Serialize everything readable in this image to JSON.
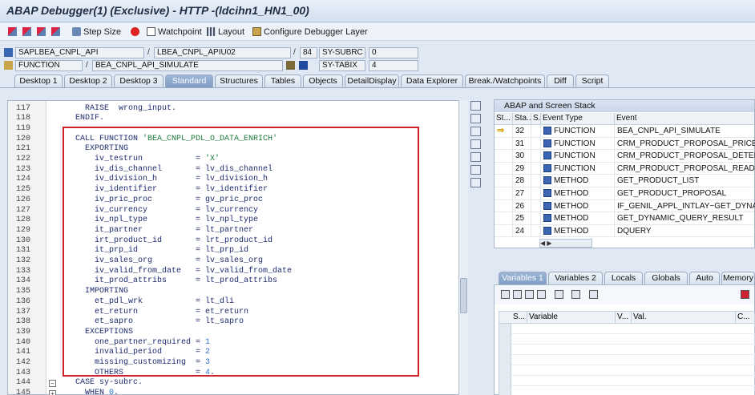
{
  "window": {
    "title": "ABAP Debugger(1)  (Exclusive) - HTTP -(ldcihn1_HN1_00)"
  },
  "toolbar": {
    "step_size": "Step Size",
    "watchpoint": "Watchpoint",
    "layout": "Layout",
    "configure": "Configure Debugger Layer"
  },
  "info": {
    "program": "SAPLBEA_CNPL_API",
    "include": "LBEA_CNPL_APIU02",
    "line": "84",
    "subrc_label": "SY-SUBRC",
    "subrc_value": "0",
    "event_type": "FUNCTION",
    "event_name": "BEA_CNPL_API_SIMULATE",
    "tabix_label": "SY-TABIX",
    "tabix_value": "4"
  },
  "tabs": [
    "Desktop 1",
    "Desktop 2",
    "Desktop 3",
    "Standard",
    "Structures",
    "Tables",
    "Objects",
    "DetailDisplay",
    "Data Explorer",
    "Break./Watchpoints",
    "Diff",
    "Script"
  ],
  "active_tab": "Standard",
  "code_lines": [
    {
      "n": "117",
      "t": "    RAISE  wrong_input."
    },
    {
      "n": "118",
      "t": "  ENDIF."
    },
    {
      "n": "119",
      "t": ""
    },
    {
      "n": "120",
      "t": "  CALL FUNCTION 'BEA_CNPL_PDL_O_DATA_ENRICH'"
    },
    {
      "n": "121",
      "t": "    EXPORTING"
    },
    {
      "n": "122",
      "t": "      iv_testrun           = 'X'"
    },
    {
      "n": "123",
      "t": "      iv_dis_channel       = lv_dis_channel"
    },
    {
      "n": "124",
      "t": "      iv_division_h        = lv_division_h"
    },
    {
      "n": "125",
      "t": "      iv_identifier        = lv_identifier"
    },
    {
      "n": "126",
      "t": "      iv_pric_proc         = gv_pric_proc"
    },
    {
      "n": "127",
      "t": "      iv_currency          = lv_currency"
    },
    {
      "n": "128",
      "t": "      iv_npl_type          = lv_npl_type"
    },
    {
      "n": "129",
      "t": "      it_partner           = lt_partner"
    },
    {
      "n": "130",
      "t": "      irt_product_id       = lrt_product_id"
    },
    {
      "n": "131",
      "t": "      it_prp_id            = lt_prp_id"
    },
    {
      "n": "132",
      "t": "      iv_sales_org         = lv_sales_org"
    },
    {
      "n": "133",
      "t": "      iv_valid_from_date   = lv_valid_from_date"
    },
    {
      "n": "134",
      "t": "      it_prod_attribs      = lt_prod_attribs"
    },
    {
      "n": "135",
      "t": "    IMPORTING"
    },
    {
      "n": "136",
      "t": "      et_pdl_wrk           = lt_dli"
    },
    {
      "n": "137",
      "t": "      et_return            = et_return"
    },
    {
      "n": "138",
      "t": "      et_sapro             = lt_sapro"
    },
    {
      "n": "139",
      "t": "    EXCEPTIONS"
    },
    {
      "n": "140",
      "t": "      one_partner_required = 1"
    },
    {
      "n": "141",
      "t": "      invalid_period       = 2"
    },
    {
      "n": "142",
      "t": "      missing_customizing  = 3"
    },
    {
      "n": "143",
      "t": "      OTHERS               = 4."
    },
    {
      "n": "144",
      "t": "  CASE sy-subrc."
    },
    {
      "n": "145",
      "t": "    WHEN 0."
    }
  ],
  "stack": {
    "title": "ABAP and Screen Stack",
    "headers": [
      "St...",
      "Sta...",
      "S...",
      "Event Type",
      "Event"
    ],
    "rows": [
      {
        "level": "32",
        "type": "FUNCTION",
        "event": "BEA_CNPL_API_SIMULATE",
        "current": true
      },
      {
        "level": "31",
        "type": "FUNCTION",
        "event": "CRM_PRODUCT_PROPOSAL_PRICEDET",
        "current": false
      },
      {
        "level": "30",
        "type": "FUNCTION",
        "event": "CRM_PRODUCT_PROPOSAL_DETERMINE",
        "current": false
      },
      {
        "level": "29",
        "type": "FUNCTION",
        "event": "CRM_PRODUCT_PROPOSAL_READ",
        "current": false
      },
      {
        "level": "28",
        "type": "METHOD",
        "event": "GET_PRODUCT_LIST",
        "current": false
      },
      {
        "level": "27",
        "type": "METHOD",
        "event": "GET_PRODUCT_PROPOSAL",
        "current": false
      },
      {
        "level": "26",
        "type": "METHOD",
        "event": "IF_GENIL_APPL_INTLAY~GET_DYNAMIC_",
        "current": false
      },
      {
        "level": "25",
        "type": "METHOD",
        "event": "GET_DYNAMIC_QUERY_RESULT",
        "current": false
      },
      {
        "level": "24",
        "type": "METHOD",
        "event": "DQUERY",
        "current": false
      }
    ]
  },
  "var_tabs": [
    "Variables 1",
    "Variables 2",
    "Locals",
    "Globals",
    "Auto",
    "Memory"
  ],
  "var_headers": [
    "S...",
    "Variable",
    "V...",
    "Val.",
    "C..."
  ]
}
